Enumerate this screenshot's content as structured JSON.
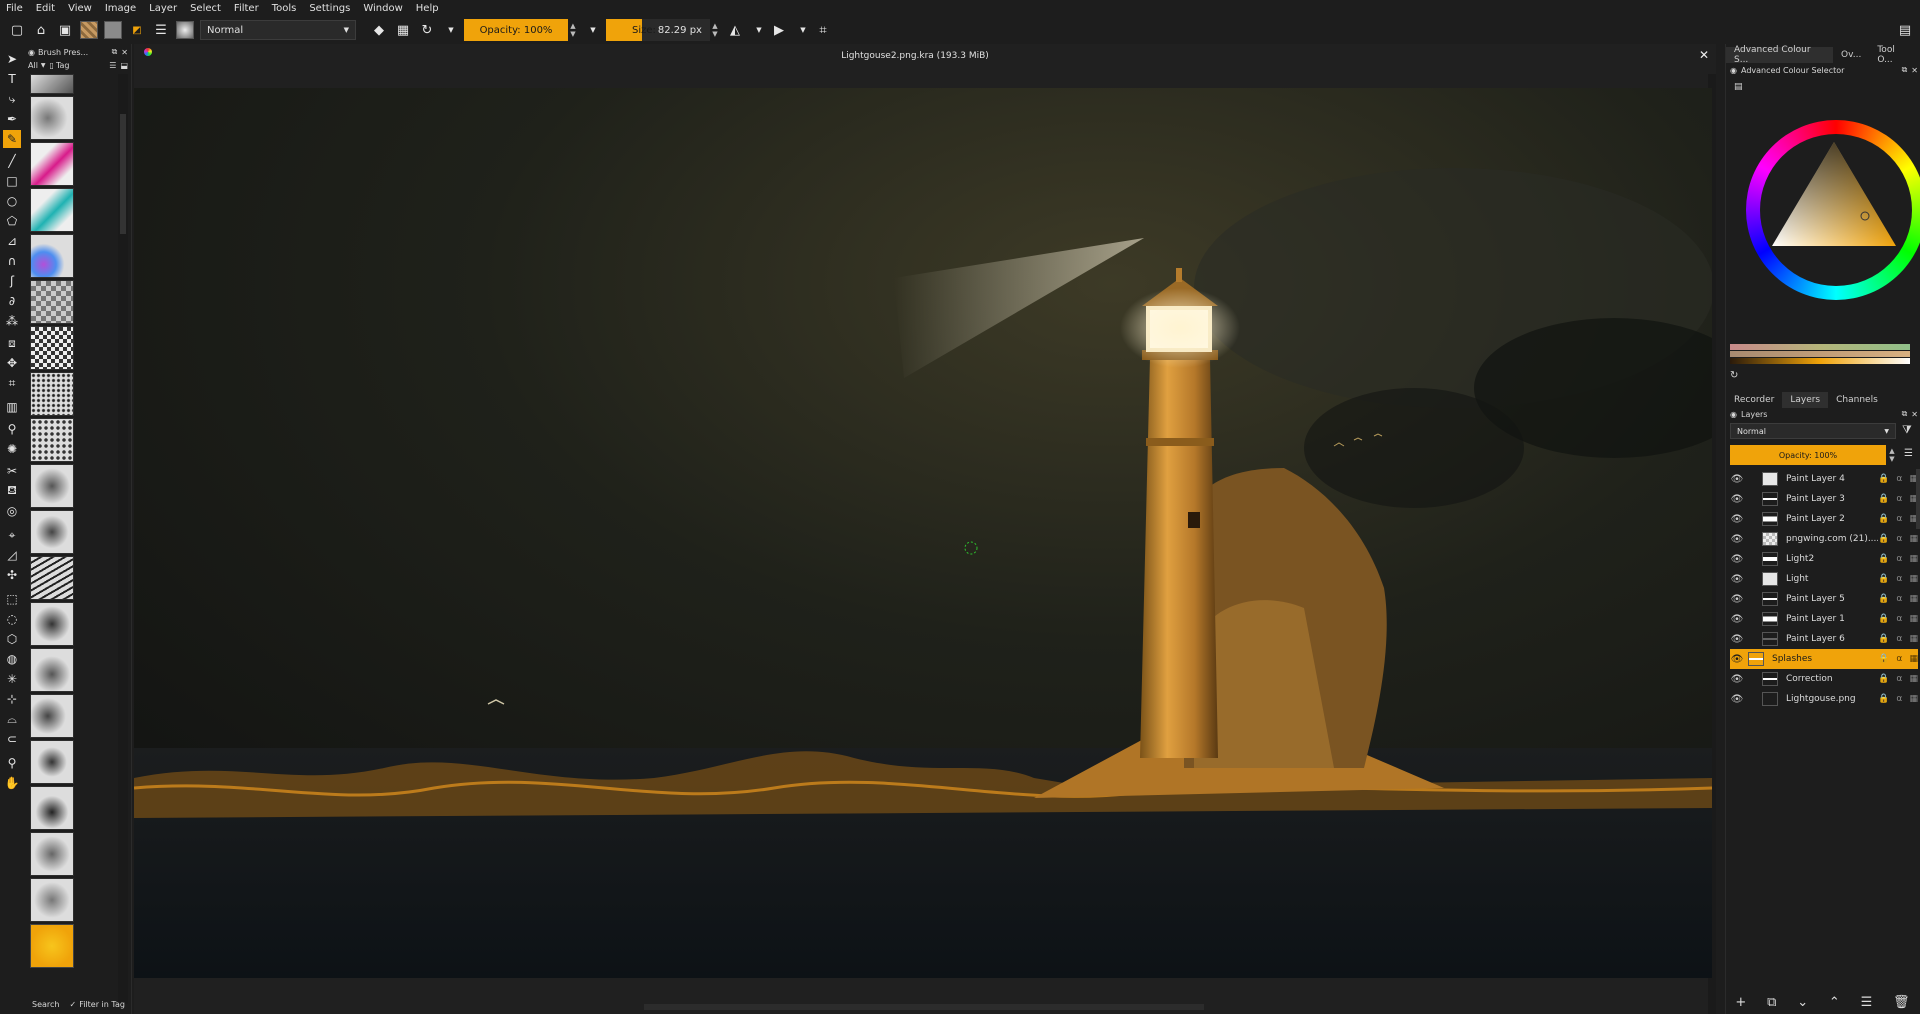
{
  "menu": [
    "File",
    "Edit",
    "View",
    "Image",
    "Layer",
    "Select",
    "Filter",
    "Tools",
    "Settings",
    "Window",
    "Help"
  ],
  "tool_options": {
    "blend_mode": "Normal",
    "opacity_label": "Opacity: 100%",
    "size_label": "Size:",
    "size_value": "82.29 px"
  },
  "document": {
    "title": "Lightgouse2.png.kra (193.3 MiB)"
  },
  "brush_presets": {
    "title": "Brush Pres...",
    "filter": "All",
    "tag_label": "Tag",
    "search_label": "Search",
    "filter_in_tag": "Filter in Tag"
  },
  "color_selector": {
    "tabs": [
      "Advanced Colour S...",
      "Ov...",
      "Tool O..."
    ],
    "title": "Advanced Colour Selector",
    "current_color": "#f0a30a"
  },
  "layers_panel": {
    "tabs": [
      "Recorder",
      "Layers",
      "Channels"
    ],
    "title": "Layers",
    "blend_mode": "Normal",
    "opacity_label": "Opacity:  100%",
    "layers": [
      {
        "name": "Paint Layer 4",
        "selected": false
      },
      {
        "name": "Paint Layer 3",
        "selected": false
      },
      {
        "name": "Paint Layer 2",
        "selected": false
      },
      {
        "name": "pngwing.com (21)....",
        "selected": false
      },
      {
        "name": "Light2",
        "selected": false
      },
      {
        "name": "Light",
        "selected": false
      },
      {
        "name": "Paint Layer 5",
        "selected": false
      },
      {
        "name": "Paint Layer 1",
        "selected": false
      },
      {
        "name": "Paint Layer 6",
        "selected": false
      },
      {
        "name": "Splashes",
        "selected": true
      },
      {
        "name": "Correction",
        "selected": false
      },
      {
        "name": "Lightgouse.png",
        "selected": false
      }
    ]
  },
  "colors": {
    "accent": "#f0a30a",
    "panel": "#1d1d1d"
  }
}
